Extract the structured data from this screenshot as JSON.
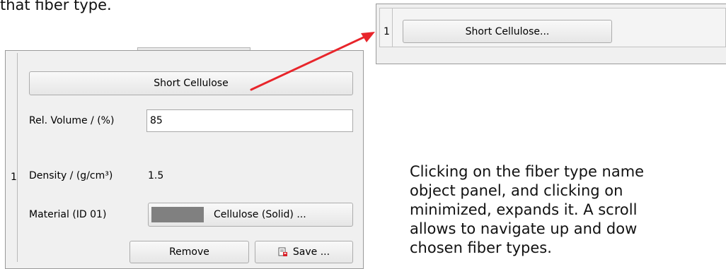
{
  "caption_top": "that fiber type.",
  "panel": {
    "fiber_type_button": "Short Cellulose",
    "row_index": "1",
    "rel_volume_label": "Rel. Volume / (%)",
    "rel_volume_value": "85",
    "density_label": "Density / (g/cm³)",
    "density_value": "1.5",
    "material_label": "Material (ID 01)",
    "material_button": "Cellulose (Solid) ...",
    "material_swatch_color": "#808080",
    "remove_button": "Remove",
    "save_button": "Save ...",
    "save_icon": "save-file-icon"
  },
  "mini_panel": {
    "row_index": "1",
    "fiber_type_button": "Short Cellulose..."
  },
  "arrow": {
    "color": "#e8252b"
  },
  "paragraph": [
    "Clicking on the fiber type name",
    "object panel, and clicking on",
    "minimized, expands it. A scroll",
    "allows to navigate up and dow",
    "chosen fiber types."
  ]
}
